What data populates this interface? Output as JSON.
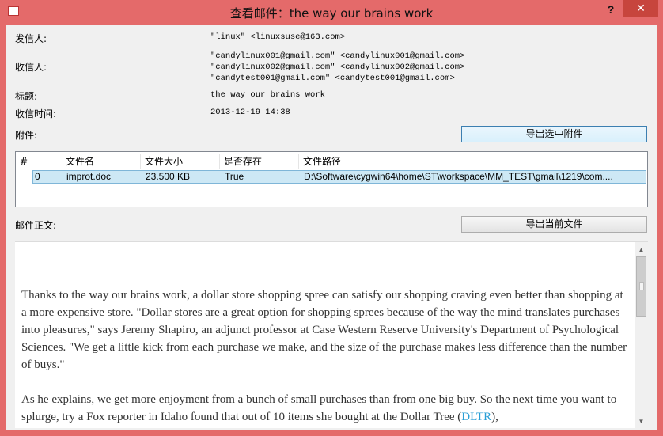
{
  "window": {
    "title": "查看邮件：the way our brains work",
    "help_label": "?",
    "close_label": "✕"
  },
  "header": {
    "from_label": "发信人:",
    "from_value": "\"linux\" <linuxsuse@163.com>",
    "to_label": "收信人:",
    "to_values": [
      "\"candylinux001@gmail.com\" <candylinux001@gmail.com>",
      "\"candylinux002@gmail.com\" <candylinux002@gmail.com>",
      "\"candytest001@gmail.com\" <candytest001@gmail.com>"
    ],
    "subject_label": "标题:",
    "subject_value": "the way our brains work",
    "time_label": "收信时间:",
    "time_value": "2013-12-19 14:38",
    "attachments_label": "附件:",
    "export_selected_label": "导出选中附件"
  },
  "attachments": {
    "columns": [
      "#",
      "文件名",
      "文件大小",
      "是否存在",
      "文件路径"
    ],
    "rows": [
      {
        "index": "0",
        "name": "improt.doc",
        "size": "23.500 KB",
        "exists": "True",
        "path": "D:\\Software\\cygwin64\\home\\ST\\workspace\\MM_TEST\\gmail\\1219\\com...."
      }
    ]
  },
  "body_section": {
    "label": "邮件正文:",
    "export_current_label": "导出当前文件",
    "paragraph1": "Thanks to the way our brains work, a dollar store shopping spree can satisfy our shopping craving even better than shopping at a more expensive store. \"Dollar stores are a great option for shopping sprees because of the way the mind translates purchases into pleasures,\" says Jeremy Shapiro, an adjunct professor at Case Western Reserve University's Department of Psychological Sciences. \"We get a little kick from each purchase we make, and the size of the purchase makes less difference than the number of buys.\"",
    "paragraph2_start": "As he explains, we get more enjoyment from a bunch of small purchases than from one big buy. So the next time you want to splurge, try  a Fox reporter in Idaho found that out of 10 items she bought at the Dollar Tree (",
    "paragraph2_link": "DLTR",
    "paragraph2_end": "),"
  },
  "colors": {
    "title_bar": "#e46a6a",
    "close_button": "#c7453d",
    "selection": "#cde8f5",
    "link": "#2a9fd6"
  }
}
